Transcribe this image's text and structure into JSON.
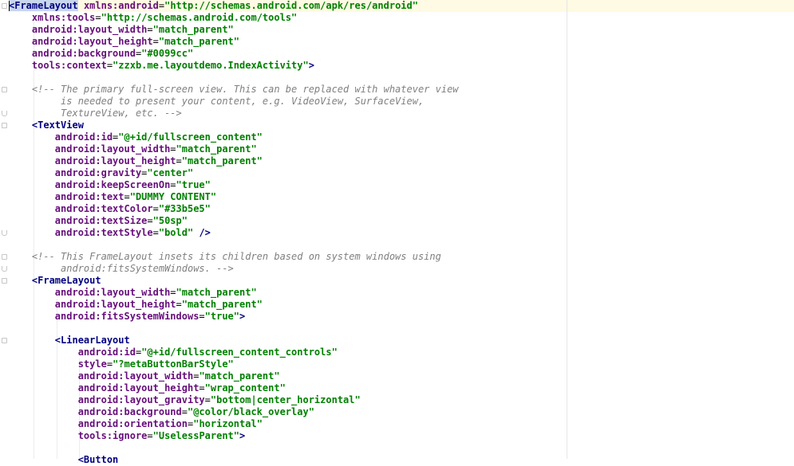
{
  "lines": [
    [
      [
        "tag hl",
        "<FrameLayout"
      ],
      [
        "txt",
        " "
      ],
      [
        "attr",
        "xmlns:android"
      ],
      [
        "txt",
        "="
      ],
      [
        "val",
        "\"http://schemas.android.com/apk/res/android\""
      ]
    ],
    [
      [
        "txt",
        "    "
      ],
      [
        "attr",
        "xmlns:tools"
      ],
      [
        "txt",
        "="
      ],
      [
        "val",
        "\"http://schemas.android.com/tools\""
      ]
    ],
    [
      [
        "txt",
        "    "
      ],
      [
        "attr",
        "android:layout_width"
      ],
      [
        "txt",
        "="
      ],
      [
        "val",
        "\"match_parent\""
      ]
    ],
    [
      [
        "txt",
        "    "
      ],
      [
        "attr",
        "android:layout_height"
      ],
      [
        "txt",
        "="
      ],
      [
        "val",
        "\"match_parent\""
      ]
    ],
    [
      [
        "txt",
        "    "
      ],
      [
        "attr",
        "android:background"
      ],
      [
        "txt",
        "="
      ],
      [
        "val",
        "\"#0099cc\""
      ]
    ],
    [
      [
        "txt",
        "    "
      ],
      [
        "attr",
        "tools:context"
      ],
      [
        "txt",
        "="
      ],
      [
        "val",
        "\"zzxb.me.layoutdemo.IndexActivity\""
      ],
      [
        "tag",
        ">"
      ]
    ],
    [],
    [
      [
        "txt",
        "    "
      ],
      [
        "cmt",
        "<!-- The primary full-screen view. This can be replaced with whatever view"
      ]
    ],
    [
      [
        "txt",
        "         "
      ],
      [
        "cmt",
        "is needed to present your content, e.g. VideoView, SurfaceView,"
      ]
    ],
    [
      [
        "txt",
        "         "
      ],
      [
        "cmt",
        "TextureView, etc. -->"
      ]
    ],
    [
      [
        "txt",
        "    "
      ],
      [
        "tag",
        "<TextView"
      ]
    ],
    [
      [
        "txt",
        "        "
      ],
      [
        "attr",
        "android:id"
      ],
      [
        "txt",
        "="
      ],
      [
        "val",
        "\"@+id/fullscreen_content\""
      ]
    ],
    [
      [
        "txt",
        "        "
      ],
      [
        "attr",
        "android:layout_width"
      ],
      [
        "txt",
        "="
      ],
      [
        "val",
        "\"match_parent\""
      ]
    ],
    [
      [
        "txt",
        "        "
      ],
      [
        "attr",
        "android:layout_height"
      ],
      [
        "txt",
        "="
      ],
      [
        "val",
        "\"match_parent\""
      ]
    ],
    [
      [
        "txt",
        "        "
      ],
      [
        "attr",
        "android:gravity"
      ],
      [
        "txt",
        "="
      ],
      [
        "val",
        "\"center\""
      ]
    ],
    [
      [
        "txt",
        "        "
      ],
      [
        "attr",
        "android:keepScreenOn"
      ],
      [
        "txt",
        "="
      ],
      [
        "val",
        "\"true\""
      ]
    ],
    [
      [
        "txt",
        "        "
      ],
      [
        "attr",
        "android:text"
      ],
      [
        "txt",
        "="
      ],
      [
        "val",
        "\"DUMMY CONTENT\""
      ]
    ],
    [
      [
        "txt",
        "        "
      ],
      [
        "attr",
        "android:textColor"
      ],
      [
        "txt",
        "="
      ],
      [
        "val",
        "\"#33b5e5\""
      ]
    ],
    [
      [
        "txt",
        "        "
      ],
      [
        "attr",
        "android:textSize"
      ],
      [
        "txt",
        "="
      ],
      [
        "val",
        "\"50sp\""
      ]
    ],
    [
      [
        "txt",
        "        "
      ],
      [
        "attr",
        "android:textStyle"
      ],
      [
        "txt",
        "="
      ],
      [
        "val",
        "\"bold\""
      ],
      [
        "txt",
        " "
      ],
      [
        "tag",
        "/>"
      ]
    ],
    [],
    [
      [
        "txt",
        "    "
      ],
      [
        "cmt",
        "<!-- This FrameLayout insets its children based on system windows using"
      ]
    ],
    [
      [
        "txt",
        "         "
      ],
      [
        "cmt",
        "android:fitsSystemWindows. -->"
      ]
    ],
    [
      [
        "txt",
        "    "
      ],
      [
        "tag",
        "<FrameLayout"
      ]
    ],
    [
      [
        "txt",
        "        "
      ],
      [
        "attr",
        "android:layout_width"
      ],
      [
        "txt",
        "="
      ],
      [
        "val",
        "\"match_parent\""
      ]
    ],
    [
      [
        "txt",
        "        "
      ],
      [
        "attr",
        "android:layout_height"
      ],
      [
        "txt",
        "="
      ],
      [
        "val",
        "\"match_parent\""
      ]
    ],
    [
      [
        "txt",
        "        "
      ],
      [
        "attr",
        "android:fitsSystemWindows"
      ],
      [
        "txt",
        "="
      ],
      [
        "val",
        "\"true\""
      ],
      [
        "tag",
        ">"
      ]
    ],
    [],
    [
      [
        "txt",
        "        "
      ],
      [
        "tag",
        "<LinearLayout"
      ]
    ],
    [
      [
        "txt",
        "            "
      ],
      [
        "attr",
        "android:id"
      ],
      [
        "txt",
        "="
      ],
      [
        "val",
        "\"@+id/fullscreen_content_controls\""
      ]
    ],
    [
      [
        "txt",
        "            "
      ],
      [
        "attr",
        "style"
      ],
      [
        "txt",
        "="
      ],
      [
        "val",
        "\"?metaButtonBarStyle\""
      ]
    ],
    [
      [
        "txt",
        "            "
      ],
      [
        "attr",
        "android:layout_width"
      ],
      [
        "txt",
        "="
      ],
      [
        "val",
        "\"match_parent\""
      ]
    ],
    [
      [
        "txt",
        "            "
      ],
      [
        "attr",
        "android:layout_height"
      ],
      [
        "txt",
        "="
      ],
      [
        "val",
        "\"wrap_content\""
      ]
    ],
    [
      [
        "txt",
        "            "
      ],
      [
        "attr",
        "android:layout_gravity"
      ],
      [
        "txt",
        "="
      ],
      [
        "val",
        "\"bottom|center_horizontal\""
      ]
    ],
    [
      [
        "txt",
        "            "
      ],
      [
        "attr",
        "android:background"
      ],
      [
        "txt",
        "="
      ],
      [
        "val",
        "\"@color/black_overlay\""
      ]
    ],
    [
      [
        "txt",
        "            "
      ],
      [
        "attr",
        "android:orientation"
      ],
      [
        "txt",
        "="
      ],
      [
        "val",
        "\"horizontal\""
      ]
    ],
    [
      [
        "txt",
        "            "
      ],
      [
        "attr",
        "tools:ignore"
      ],
      [
        "txt",
        "="
      ],
      [
        "val",
        "\"UselessParent\""
      ],
      [
        "tag",
        ">"
      ]
    ],
    [],
    [
      [
        "txt",
        "            "
      ],
      [
        "tag",
        "<Button"
      ]
    ]
  ],
  "folds": [
    {
      "line": 0,
      "kind": "start"
    },
    {
      "line": 7,
      "kind": "start"
    },
    {
      "line": 9,
      "kind": "end"
    },
    {
      "line": 10,
      "kind": "start"
    },
    {
      "line": 19,
      "kind": "end"
    },
    {
      "line": 21,
      "kind": "start"
    },
    {
      "line": 22,
      "kind": "end"
    },
    {
      "line": 23,
      "kind": "start"
    },
    {
      "line": 28,
      "kind": "start"
    }
  ]
}
